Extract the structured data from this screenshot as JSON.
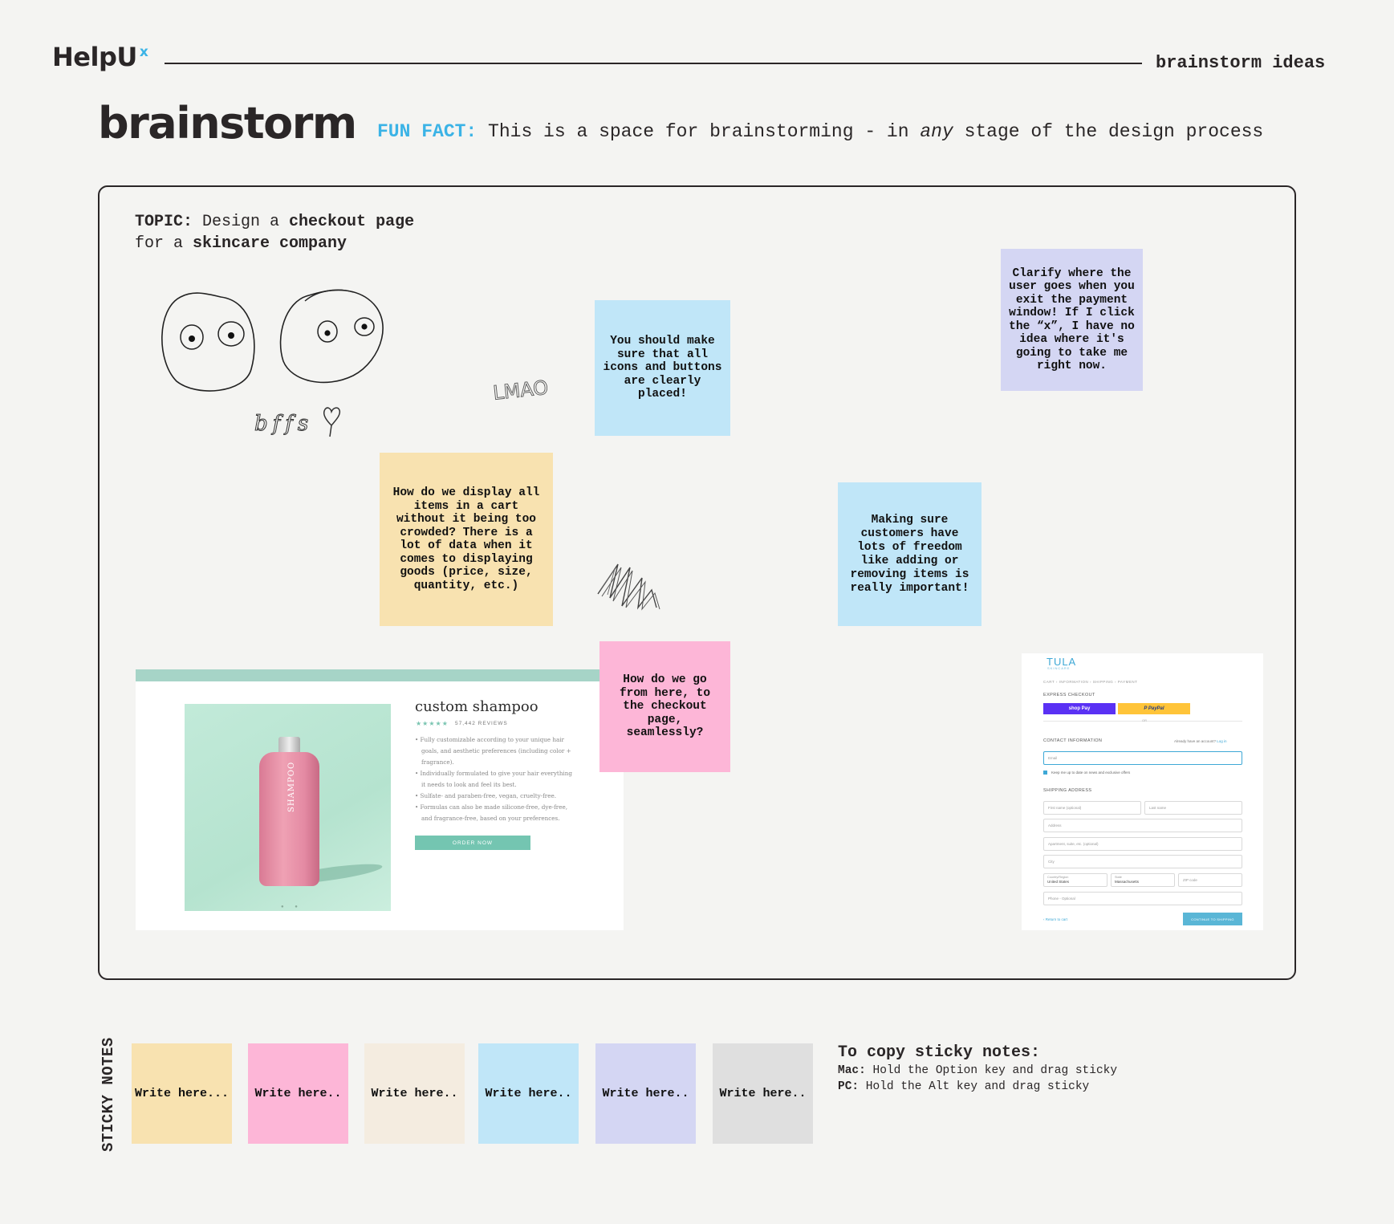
{
  "header": {
    "logo_text": "HelpU",
    "logo_superscript": "x",
    "label": "brainstorm ideas"
  },
  "page": {
    "title": "brainstorm",
    "fun_fact_label": "FUN FACT:",
    "fun_fact_before": "This is a space for brainstorming - in ",
    "fun_fact_emphasis": "any",
    "fun_fact_after": " stage of the design process"
  },
  "board": {
    "topic_label": "TOPIC:",
    "topic_text_1": " Design a ",
    "topic_bold_1": "checkout page",
    "topic_text_2": "for a ",
    "topic_bold_2": "skincare company",
    "doodle_text_bffs": "bffs",
    "doodle_text_lmao": "LMAO",
    "notes": [
      {
        "text": "You should make sure that all icons and buttons are clearly placed!",
        "color": "#c0e6f8"
      },
      {
        "text": "Clarify where the user goes when you exit the payment window! If I click the “x”, I have no idea where it's going to take me right now.",
        "color": "#d4d6f3"
      },
      {
        "text": "How do we display all items in a cart without it being too crowded? There is a lot of data when it comes to displaying goods (price, size, quantity, etc.)",
        "color": "#f8e2b0"
      },
      {
        "text": "Making sure customers have lots of freedom like adding or removing items is really important!",
        "color": "#c0e6f8"
      },
      {
        "text": "How do we go from here, to the checkout page, seamlessly?",
        "color": "#fdb6d7"
      }
    ]
  },
  "shampoo": {
    "bottle_label": "SHAMPOO",
    "title": "custom shampoo",
    "stars": "★★★★★",
    "reviews": "57,442 REVIEWS",
    "features": [
      "Fully customizable according to your unique hair goals, and aesthetic preferences (including color + fragrance).",
      "Individually formulated to give your hair everything it needs to look and feel its best.",
      "Sulfate- and paraben-free, vegan, cruelty-free.",
      "Formulas can also be made silicone-free, dye-free, and fragrance-free, based on your preferences."
    ],
    "order_button": "ORDER NOW",
    "dots": "● ●"
  },
  "tula": {
    "logo": "TULA",
    "logo_sub": "SKINCARE",
    "steps": "CART  ›  INFORMATION  ›  SHIPPING  ›  PAYMENT",
    "express_checkout": "EXPRESS CHECKOUT",
    "shop_pay": "shop Pay",
    "paypal": "P PayPal",
    "or": "OR",
    "contact_heading": "CONTACT INFORMATION",
    "login_prompt": "Already have an account? ",
    "login_link": "Log in",
    "email_placeholder": "Email",
    "newsletter": "Keep me up to date on news and exclusive offers",
    "shipping_heading": "SHIPPING ADDRESS",
    "first_name": "First name (optional)",
    "last_name": "Last name",
    "address": "Address",
    "apartment": "Apartment, suite, etc. (optional)",
    "city": "City",
    "country_label": "Country/Region",
    "country_value": "United States",
    "state_label": "State",
    "state_value": "Massachusetts",
    "zip": "ZIP code",
    "phone": "Phone - Optional",
    "return_link": "‹ Return to cart",
    "continue_button": "CONTINUE TO SHIPPING"
  },
  "sticky_palette": {
    "label": "STICKY NOTES",
    "swatches": [
      {
        "text": "Write here...",
        "color": "#f8e2b0"
      },
      {
        "text": "Write here..",
        "color": "#fdb6d7"
      },
      {
        "text": "Write here..",
        "color": "#f4ece0"
      },
      {
        "text": "Write here..",
        "color": "#c0e6f8"
      },
      {
        "text": "Write here..",
        "color": "#d4d6f3"
      },
      {
        "text": "Write here..",
        "color": "#dfdfdf"
      }
    ]
  },
  "instructions": {
    "title": "To copy sticky notes:",
    "mac_label": "Mac:",
    "mac_text": " Hold the Option key and drag sticky",
    "pc_label": "PC:",
    "pc_text": " Hold the Alt key and drag sticky"
  }
}
